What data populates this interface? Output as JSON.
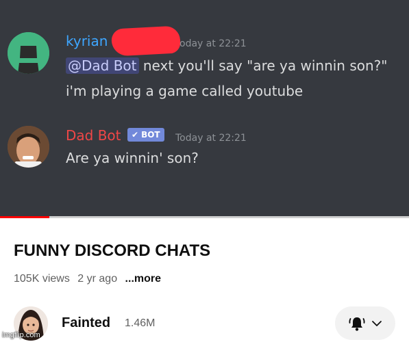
{
  "video": {
    "messages": [
      {
        "username": "kyrian",
        "timestamp": "oday at 22:21",
        "lines": [
          {
            "mention": "@Dad Bot",
            "text": " next you'll say \"are ya winnin son?\""
          },
          {
            "text": "i'm playing a game called youtube"
          }
        ]
      },
      {
        "username": "Dad Bot",
        "badge": "BOT",
        "timestamp": "Today at 22:21",
        "lines": [
          {
            "text": "Are ya winnin' son?"
          }
        ]
      }
    ],
    "progress": 0.12
  },
  "title": "FUNNY DISCORD CHATS",
  "meta": {
    "views": "105K views",
    "age": "2 yr ago",
    "more": "...more"
  },
  "channel": {
    "name": "Fainted",
    "subscribers": "1.46M"
  },
  "watermark": "imgflip.com",
  "colors": {
    "discord_bg": "#36393f",
    "username_1": "#3ea6ff",
    "username_2": "#f04747",
    "bot_badge": "#7289da",
    "progress": "#ff0000"
  },
  "icons": {
    "subscribe_bell": "bell-ringing-icon",
    "subscribe_dropdown": "chevron-down-icon"
  }
}
